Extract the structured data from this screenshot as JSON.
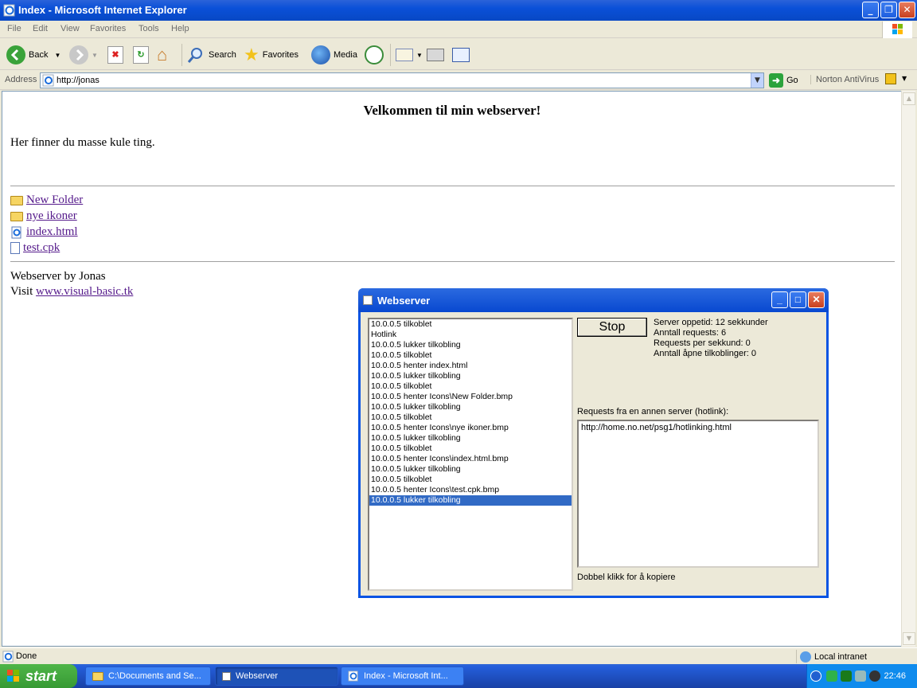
{
  "ie": {
    "title": "Index - Microsoft Internet Explorer",
    "menus": [
      "File",
      "Edit",
      "View",
      "Favorites",
      "Tools",
      "Help"
    ],
    "toolbar": {
      "back": "Back",
      "search": "Search",
      "favorites": "Favorites",
      "media": "Media"
    },
    "address": {
      "label": "Address",
      "url": "http://jonas",
      "go": "Go",
      "norton": "Norton AntiVirus"
    },
    "status": "Done",
    "zone": "Local intranet"
  },
  "page": {
    "heading": "Velkommen til min webserver!",
    "intro": "Her finner du masse kule ting.",
    "files": [
      {
        "name": "New Folder",
        "icon": "folder-icon"
      },
      {
        "name": "nye ikoner",
        "icon": "folder-icon"
      },
      {
        "name": "index.html",
        "icon": "ie-document-icon"
      },
      {
        "name": "test.cpk",
        "icon": "document-icon"
      }
    ],
    "footer_line1": "Webserver by Jonas",
    "footer_visit": "Visit",
    "footer_link": "www.visual-basic.tk"
  },
  "webserver": {
    "title": "Webserver",
    "log": [
      "10.0.0.5 tilkoblet",
      "Hotlink",
      "10.0.0.5 lukker tilkobling",
      "10.0.0.5 tilkoblet",
      "10.0.0.5 henter index.html",
      "10.0.0.5 lukker tilkobling",
      "10.0.0.5 tilkoblet",
      "10.0.0.5 henter Icons\\New Folder.bmp",
      "10.0.0.5 lukker tilkobling",
      "10.0.0.5 tilkoblet",
      "10.0.0.5 henter Icons\\nye ikoner.bmp",
      "10.0.0.5 lukker tilkobling",
      "10.0.0.5 tilkoblet",
      "10.0.0.5 henter Icons\\index.html.bmp",
      "10.0.0.5 lukker tilkobling",
      "10.0.0.5 tilkoblet",
      "10.0.0.5 henter Icons\\test.cpk.bmp",
      "10.0.0.5 lukker tilkobling"
    ],
    "selected_log_index": 17,
    "stop_label": "Stop",
    "stats": {
      "uptime": "Server oppetid: 12 sekkunder",
      "requests": "Anntall requests: 6",
      "per_second": "Requests per sekkund: 0",
      "open_connections": "Anntall åpne tilkoblinger: 0"
    },
    "hotlink_label": "Requests fra en annen server (hotlink):",
    "hotlink_items": [
      "http://home.no.net/psg1/hotlinking.html"
    ],
    "copy_hint": "Dobbel klikk for å kopiere"
  },
  "taskbar": {
    "start": "start",
    "tasks": [
      {
        "label": "C:\\Documents and Se...",
        "icon": "folder-icon"
      },
      {
        "label": "Webserver",
        "icon": "app-window-icon"
      },
      {
        "label": "Index - Microsoft Int...",
        "icon": "ie-icon"
      }
    ],
    "clock": "22:46"
  },
  "colors": {
    "xp_blue": "#0a50d8",
    "selection": "#316ac5",
    "start_green": "#3f9f3a",
    "visited_link": "#551a8b"
  }
}
